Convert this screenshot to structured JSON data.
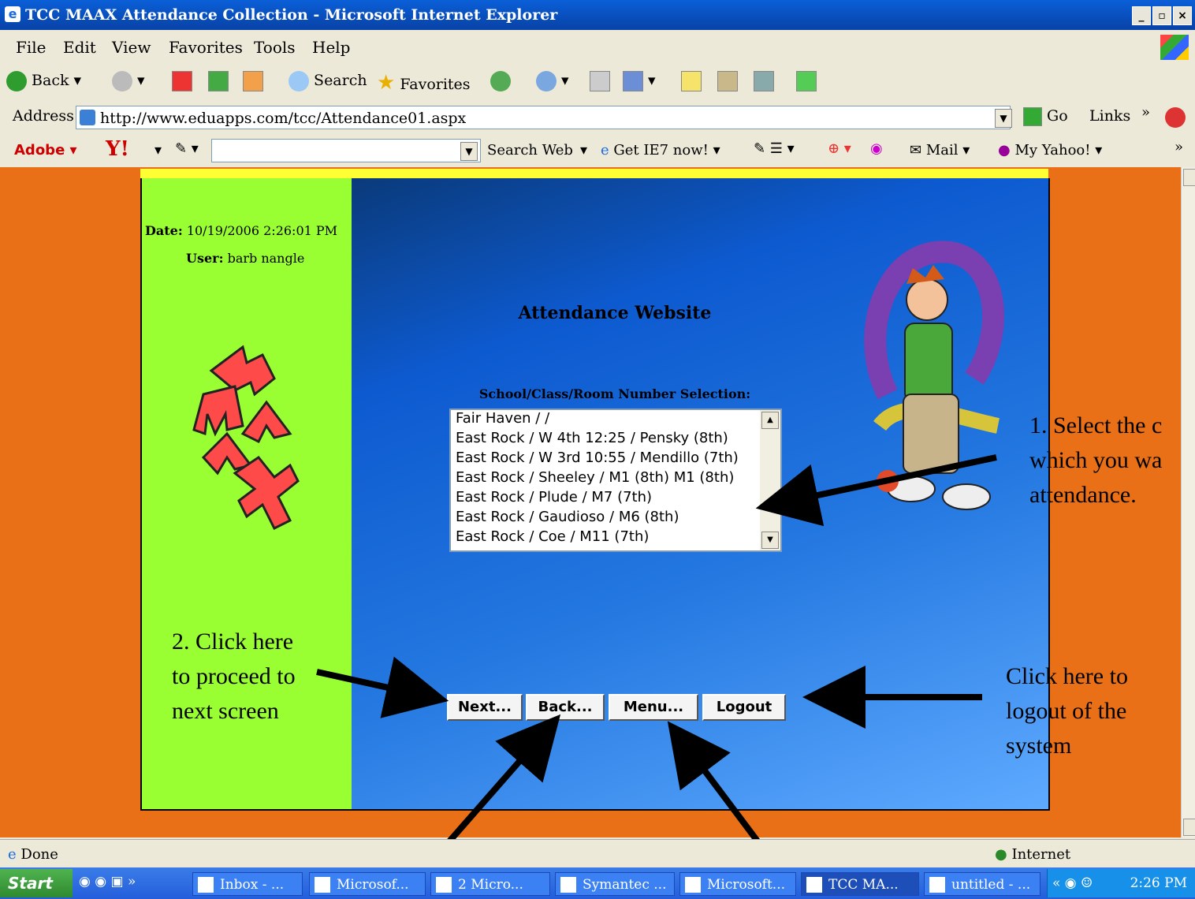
{
  "window": {
    "title": "TCC MAAX Attendance Collection - Microsoft Internet Explorer"
  },
  "menu": [
    "File",
    "Edit",
    "View",
    "Favorites",
    "Tools",
    "Help"
  ],
  "toolbar": {
    "back": "Back",
    "search": "Search",
    "favorites": "Favorites"
  },
  "address": {
    "label": "Address",
    "url": "http://www.eduapps.com/tcc/Attendance01.aspx",
    "go": "Go",
    "links": "Links"
  },
  "yahoo": {
    "adobe": "Adobe",
    "search_web": "Search Web",
    "get_ie7": "Get IE7 now!",
    "mail": "Mail",
    "my_yahoo": "My Yahoo!"
  },
  "page": {
    "date_label": "Date:",
    "date_value": "10/19/2006 2:26:01 PM",
    "user_label": "User:",
    "user_value": "barb nangle",
    "title": "Attendance Website",
    "selection_label": "School/Class/Room Number Selection:",
    "list_items": [
      "Fair Haven / /",
      "East Rock / W 4th 12:25 / Pensky (8th)",
      "East Rock / W 3rd 10:55 / Mendillo (7th)",
      "East Rock / Sheeley / M1 (8th) M1 (8th)",
      "East Rock / Plude / M7 (7th)",
      "East Rock / Gaudioso / M6 (8th)",
      "East Rock / Coe / M11 (7th)"
    ],
    "buttons": {
      "next": "Next...",
      "back": "Back...",
      "menu": "Menu...",
      "logout": "Logout"
    }
  },
  "annotations": {
    "select": [
      "1. Select the c",
      "which you wa",
      "attendance."
    ],
    "proceed": [
      "2. Click here",
      "to proceed to",
      "next screen"
    ],
    "logout": [
      "Click here to",
      "logout of the",
      "system"
    ]
  },
  "status": {
    "text": "Done",
    "zone": "Internet"
  },
  "taskbar": {
    "start": "Start",
    "items": [
      "Inbox - ...",
      "Microsof...",
      "2 Micro...",
      "Symantec ...",
      "Microsoft...",
      "TCC MA...",
      "untitled - ..."
    ],
    "time": "2:26 PM"
  }
}
